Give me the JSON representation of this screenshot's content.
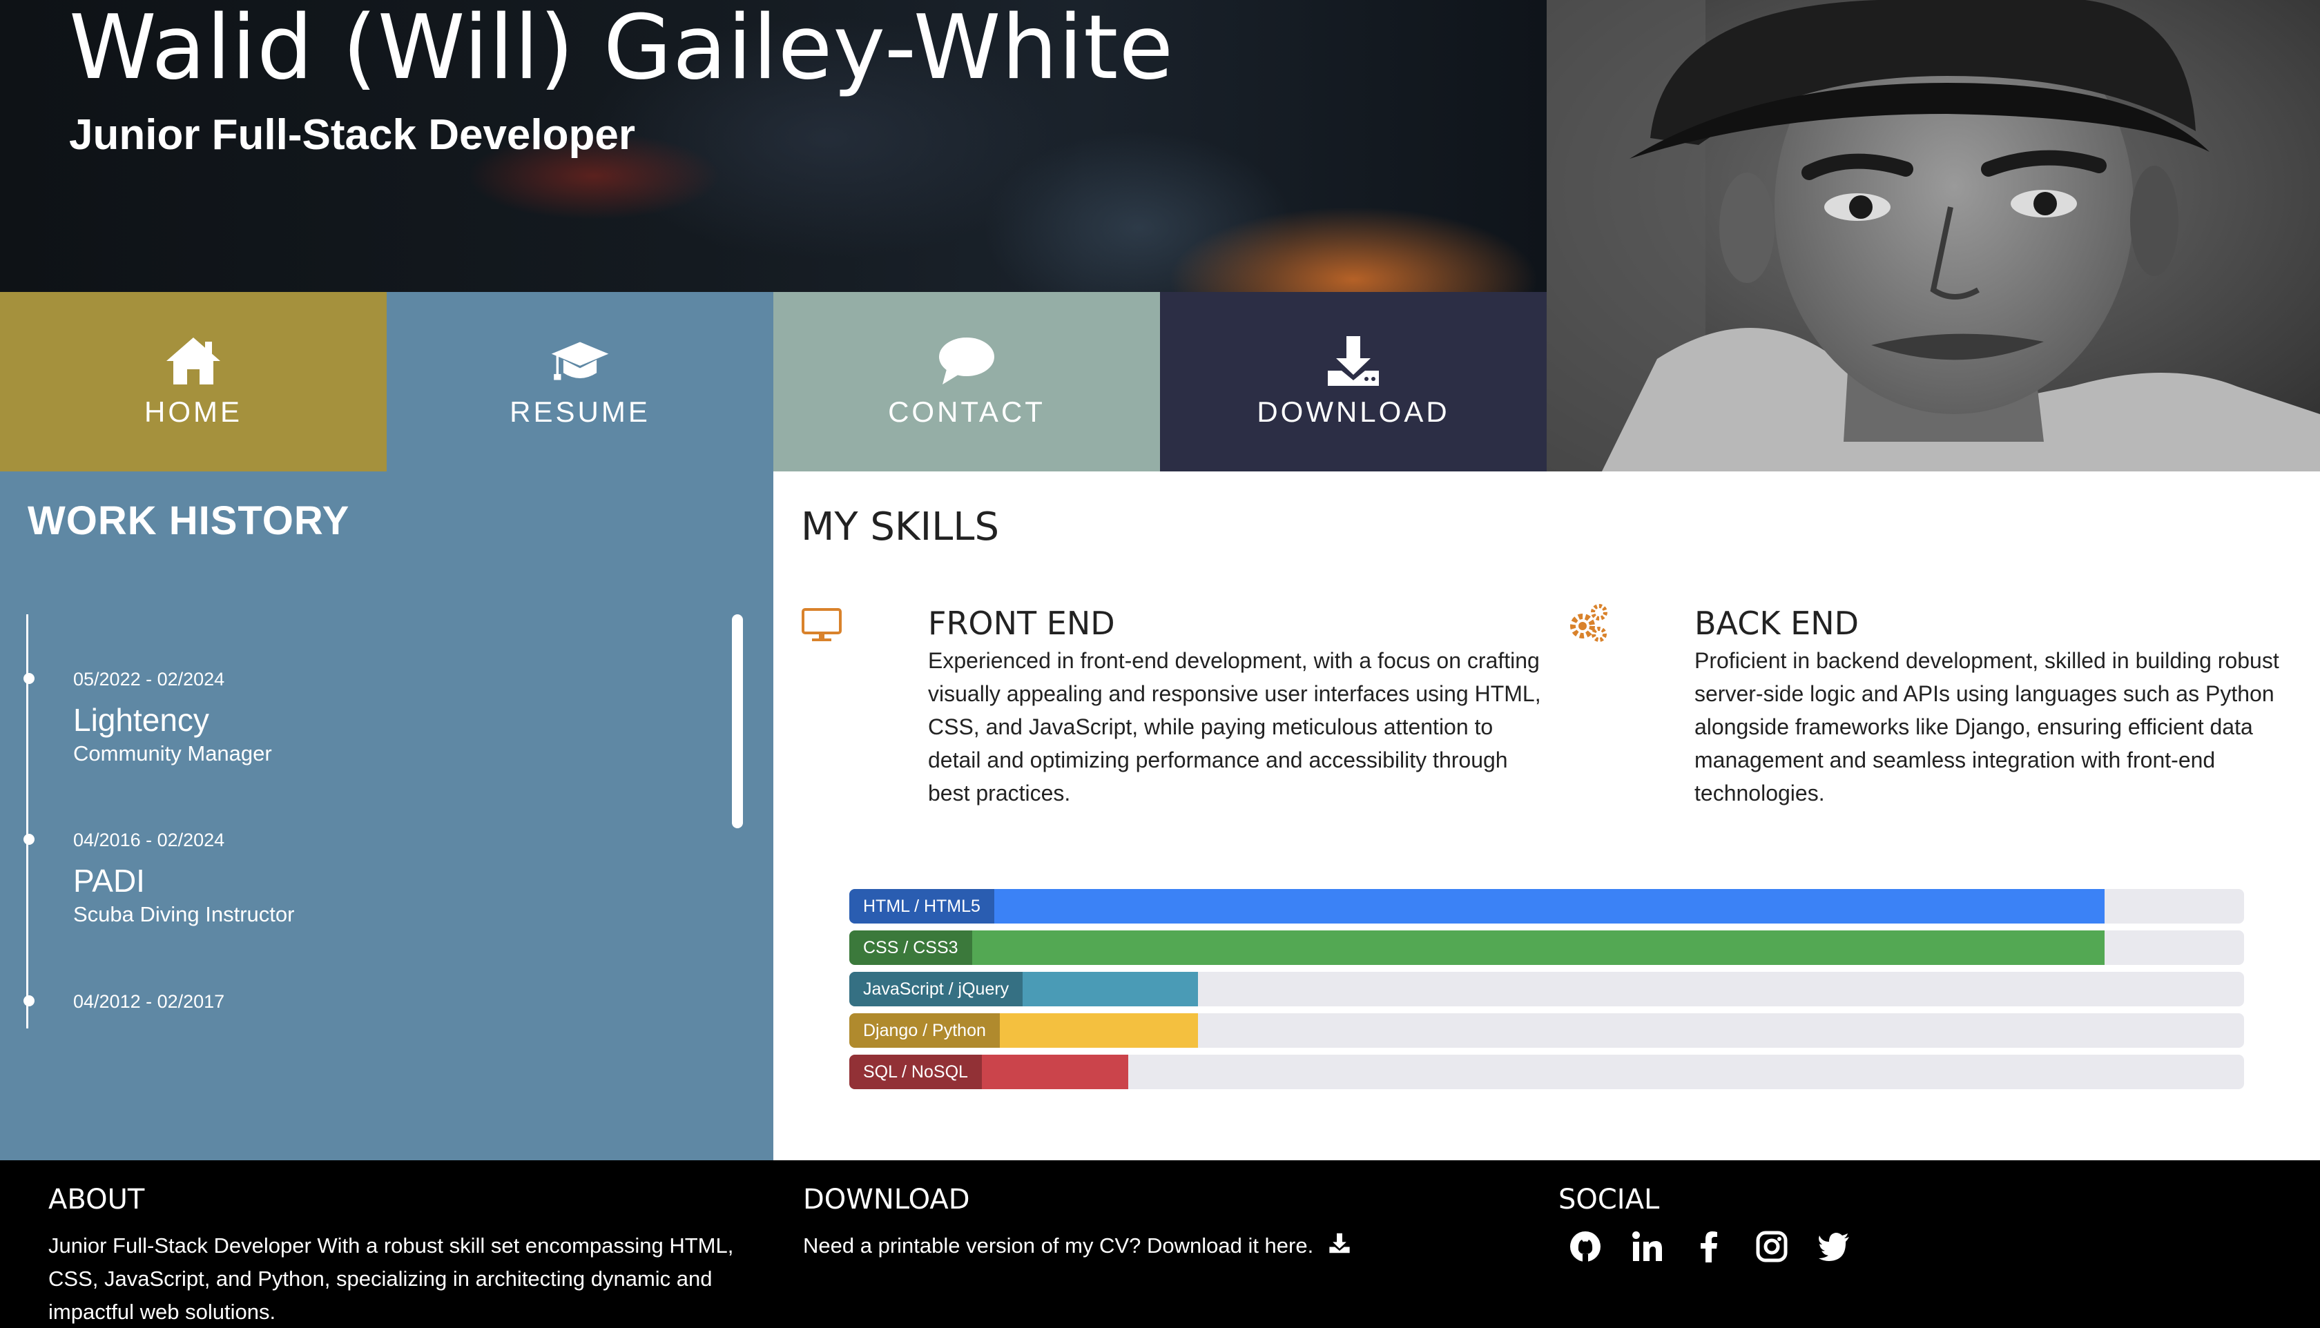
{
  "hero": {
    "name": "Walid (Will) Gailey-White",
    "subtitle": "Junior Full-Stack Developer"
  },
  "nav": [
    {
      "label": "HOME",
      "icon": "home-icon",
      "color": "#a5913d"
    },
    {
      "label": "RESUME",
      "icon": "graduation-cap-icon",
      "color": "#5f88a4"
    },
    {
      "label": "CONTACT",
      "icon": "speech-bubble-icon",
      "color": "#95aea6"
    },
    {
      "label": "DOWNLOAD",
      "icon": "download-icon",
      "color": "#2c2e45"
    }
  ],
  "work_history": {
    "heading": "WORK HISTORY",
    "entries": [
      {
        "dates": "05/2022 - 02/2024",
        "company": "Lightency",
        "role": "Community Manager"
      },
      {
        "dates": "04/2016 - 02/2024",
        "company": "PADI",
        "role": "Scuba Diving Instructor"
      },
      {
        "dates": "04/2012 - 02/2017",
        "company": "",
        "role": ""
      }
    ]
  },
  "skills": {
    "heading": "MY SKILLS",
    "front_end": {
      "title": "FRONT END",
      "icon": "monitor-icon",
      "text": "Experienced in front-end development, with a focus on crafting visually appealing and responsive user interfaces using HTML, CSS, and JavaScript, while paying meticulous attention to detail and optimizing performance and accessibility through best practices."
    },
    "back_end": {
      "title": "BACK END",
      "icon": "gears-icon",
      "text": "Proficient in backend development, skilled in building robust server-side logic and APIs using languages such as Python alongside frameworks like Django, ensuring efficient data management and seamless integration with front-end technologies."
    },
    "bars": [
      {
        "label": "HTML / HTML5",
        "percent": 90,
        "color": "#3b82f6"
      },
      {
        "label": "CSS / CSS3",
        "percent": 90,
        "color": "#53a853"
      },
      {
        "label": "JavaScript / jQuery",
        "percent": 25,
        "color": "#4a9bb6"
      },
      {
        "label": "Django / Python",
        "percent": 25,
        "color": "#f4c03f"
      },
      {
        "label": "SQL / NoSQL",
        "percent": 20,
        "color": "#cb444b"
      }
    ]
  },
  "footer": {
    "about": {
      "heading": "ABOUT",
      "text": "Junior Full-Stack Developer With a robust skill set encompassing HTML, CSS, JavaScript, and Python, specializing in architecting dynamic and impactful web solutions."
    },
    "download": {
      "heading": "DOWNLOAD",
      "text": "Need a printable version of my CV? Download it here."
    },
    "social": {
      "heading": "SOCIAL",
      "icons": [
        "github-icon",
        "linkedin-icon",
        "facebook-icon",
        "instagram-icon",
        "twitter-icon"
      ]
    }
  }
}
